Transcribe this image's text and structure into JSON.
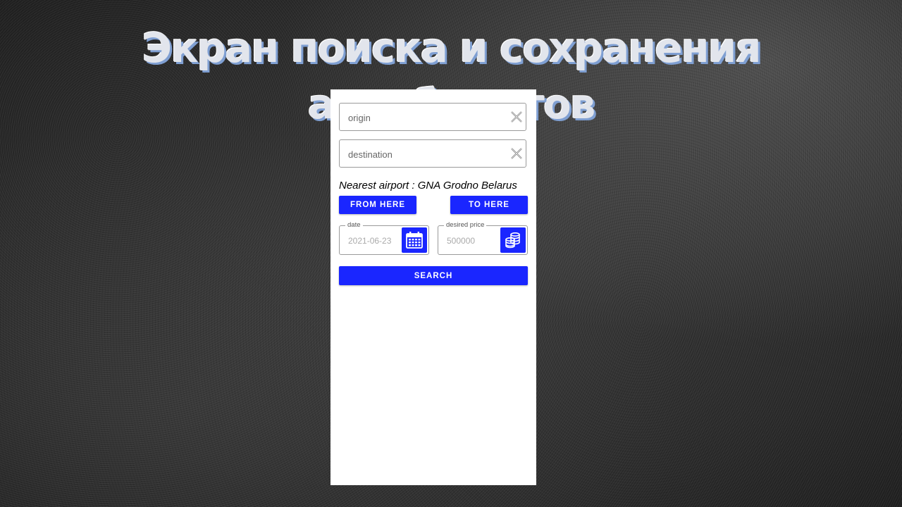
{
  "slide": {
    "title": "Экран поиска и сохранения авиабилетов"
  },
  "search_form": {
    "origin_placeholder": "origin",
    "destination_placeholder": "destination",
    "nearest_airport_text": "Nearest airport : GNA Grodno Belarus",
    "from_here_label": "FROM HERE",
    "to_here_label": "TO HERE",
    "date": {
      "label": "date",
      "value": "2021-06-23"
    },
    "price": {
      "label": "desired price",
      "value": "500000"
    },
    "search_label": "SEARCH"
  },
  "colors": {
    "accent": "#1a26ff",
    "background": "#2e2e2e",
    "panel": "#ffffff"
  },
  "icons": [
    "clear-icon",
    "calendar-icon",
    "coins-icon"
  ]
}
